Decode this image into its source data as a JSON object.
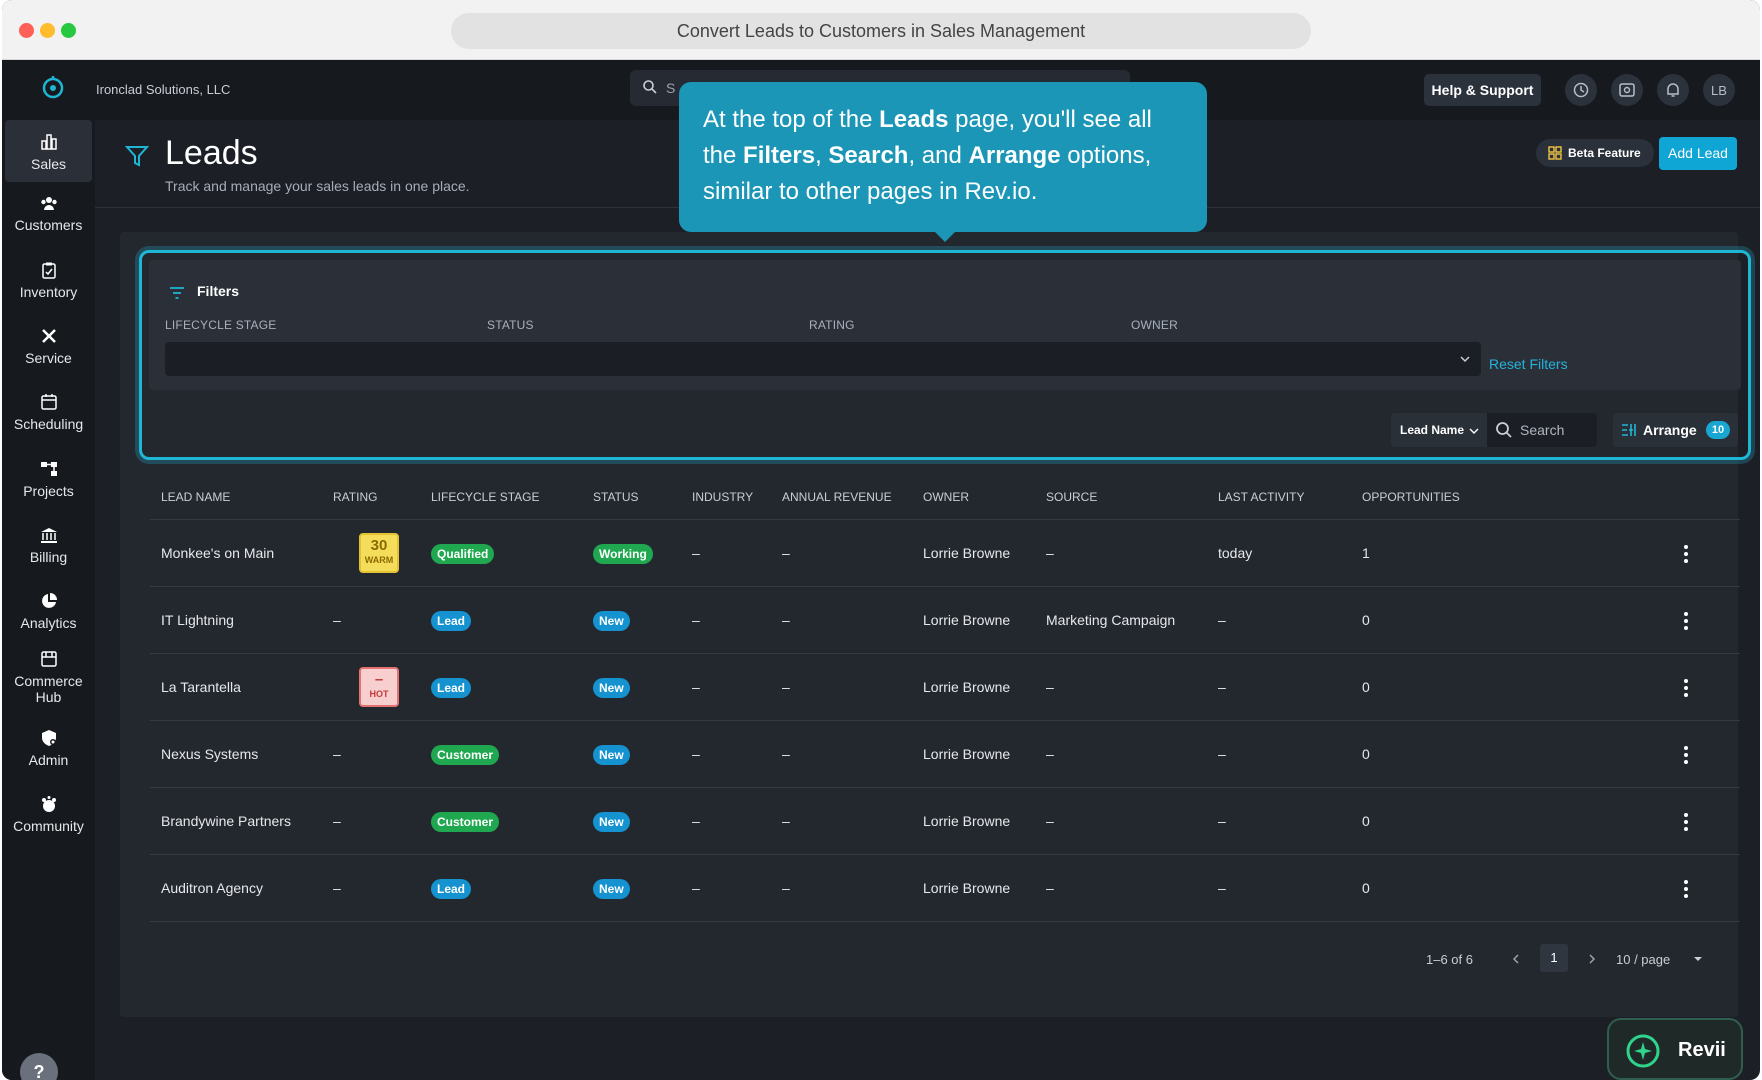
{
  "window": {
    "title": "Convert Leads to Customers in Sales Management"
  },
  "topbar": {
    "company": "Ironclad Solutions, LLC",
    "search_placeholder": "S",
    "help_label": "Help & Support",
    "avatar_initials": "LB"
  },
  "sidebar": {
    "items": [
      {
        "label": "Sales",
        "icon": "chart-bar-icon"
      },
      {
        "label": "Customers",
        "icon": "people-icon"
      },
      {
        "label": "Inventory",
        "icon": "clipboard-icon"
      },
      {
        "label": "Service",
        "icon": "tools-icon"
      },
      {
        "label": "Scheduling",
        "icon": "calendar-icon"
      },
      {
        "label": "Projects",
        "icon": "hierarchy-icon"
      },
      {
        "label": "Billing",
        "icon": "bank-icon"
      },
      {
        "label": "Analytics",
        "icon": "pie-chart-icon"
      },
      {
        "label": "Commerce",
        "label2": "Hub",
        "icon": "store-icon"
      },
      {
        "label": "Admin",
        "icon": "shield-gear-icon"
      },
      {
        "label": "Community",
        "icon": "community-icon"
      }
    ],
    "help": "?"
  },
  "page": {
    "title": "Leads",
    "subtitle": "Track and manage your sales leads in one place.",
    "beta_label": "Beta Feature",
    "add_lead_label": "Add Lead"
  },
  "filters": {
    "title": "Filters",
    "fields": [
      "LIFECYCLE STAGE",
      "STATUS",
      "RATING",
      "OWNER"
    ],
    "reset_label": "Reset Filters"
  },
  "toolbar": {
    "search_field": "Lead Name",
    "search_placeholder": "Search",
    "arrange_label": "Arrange",
    "arrange_count": "10"
  },
  "table": {
    "columns": [
      "LEAD NAME",
      "RATING",
      "LIFECYCLE STAGE",
      "STATUS",
      "INDUSTRY",
      "ANNUAL REVENUE",
      "OWNER",
      "SOURCE",
      "LAST ACTIVITY",
      "OPPORTUNITIES"
    ],
    "rows": [
      {
        "name": "Monkee's on Main",
        "rating": "30",
        "rating_label": "WARM",
        "stage": "Qualified",
        "status": "Working",
        "industry": "–",
        "revenue": "–",
        "owner": "Lorrie Browne",
        "source": "–",
        "last_activity": "today",
        "opportunities": "1"
      },
      {
        "name": "IT Lightning",
        "rating": "–",
        "rating_label": "",
        "stage": "Lead",
        "status": "New",
        "industry": "–",
        "revenue": "–",
        "owner": "Lorrie Browne",
        "source": "Marketing Campaign",
        "last_activity": "–",
        "opportunities": "0"
      },
      {
        "name": "La Tarantella",
        "rating": "–",
        "rating_label": "HOT",
        "stage": "Lead",
        "status": "New",
        "industry": "–",
        "revenue": "–",
        "owner": "Lorrie Browne",
        "source": "–",
        "last_activity": "–",
        "opportunities": "0"
      },
      {
        "name": "Nexus Systems",
        "rating": "–",
        "rating_label": "",
        "stage": "Customer",
        "status": "New",
        "industry": "–",
        "revenue": "–",
        "owner": "Lorrie Browne",
        "source": "–",
        "last_activity": "–",
        "opportunities": "0"
      },
      {
        "name": "Brandywine Partners",
        "rating": "–",
        "rating_label": "",
        "stage": "Customer",
        "status": "New",
        "industry": "–",
        "revenue": "–",
        "owner": "Lorrie Browne",
        "source": "–",
        "last_activity": "–",
        "opportunities": "0"
      },
      {
        "name": "Auditron Agency",
        "rating": "–",
        "rating_label": "",
        "stage": "Lead",
        "status": "New",
        "industry": "–",
        "revenue": "–",
        "owner": "Lorrie Browne",
        "source": "–",
        "last_activity": "–",
        "opportunities": "0"
      }
    ]
  },
  "pagination": {
    "range": "1–6 of 6",
    "page": "1",
    "per_page": "10 / page"
  },
  "tooltip": {
    "t1": "At the top of the ",
    "b1": "Leads",
    "t2": " page, you'll see all the ",
    "b2": "Filters",
    "t3": ", ",
    "b3": "Search",
    "t4": ", and ",
    "b4": "Arrange",
    "t5": " options, similar to other pages in Rev.io."
  },
  "assistant": {
    "label": "Revii"
  },
  "colors": {
    "accent": "#0fa6d6",
    "highlight": "#1fb6d6",
    "tooltip": "#1c96b6",
    "green": "#1fa84f",
    "blue": "#1592d0"
  }
}
